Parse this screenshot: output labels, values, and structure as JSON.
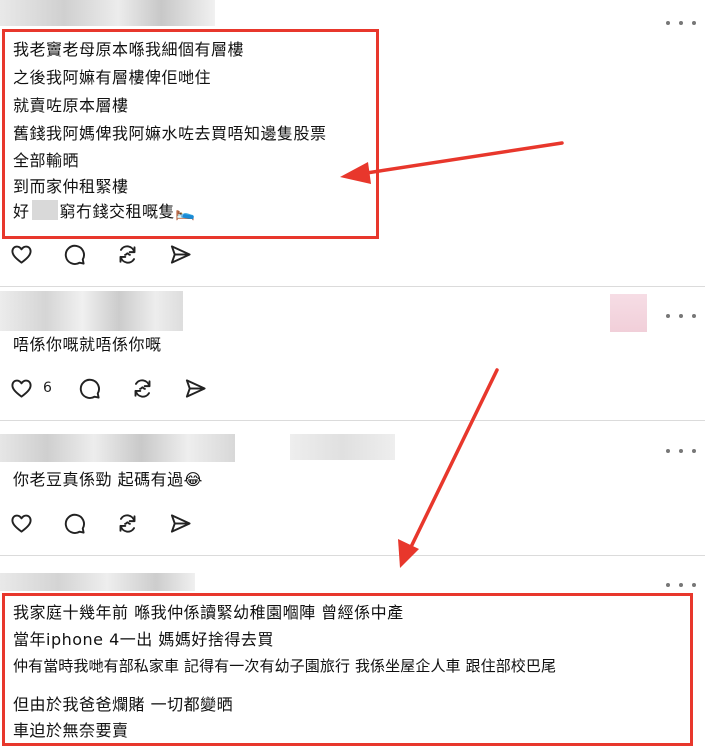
{
  "theme": {
    "accent_red": "#e8372c",
    "text": "#111111",
    "icon": "#222222",
    "divider": "#dbdbdb"
  },
  "comments": [
    {
      "lines": [
        "我老竇老母原本喺我細個有層樓",
        "之後我阿嫲有層樓俾佢哋住",
        "就賣咗原本層樓",
        "舊錢我阿媽俾我阿嫲水咗去買唔知邊隻股票",
        "全部輸晒",
        "到而家仲租緊樓",
        "好",
        "窮冇錢交租嘅隻🛌"
      ],
      "like_count": ""
    },
    {
      "lines": [
        "唔係你嘅就唔係你嘅"
      ],
      "like_count": "6"
    },
    {
      "lines": [
        "你老豆真係勁 起碼有過😂"
      ],
      "like_count": ""
    },
    {
      "lines": [
        "我家庭十幾年前 喺我仲係讀緊幼稚園嗰陣 曾經係中產",
        "當年iphone 4一出 媽媽好捨得去買",
        "仲有當時我哋有部私家車 記得有一次有幼子園旅行 我係坐屋企人車 跟住部校巴尾",
        "但由於我爸爸爛賭 一切都變晒",
        "車迫於無奈要賣"
      ]
    }
  ],
  "icons": {
    "like": "heart-icon",
    "reply": "comment-icon",
    "repost": "repost-icon",
    "share": "send-icon",
    "more": "more-dots-icon"
  }
}
